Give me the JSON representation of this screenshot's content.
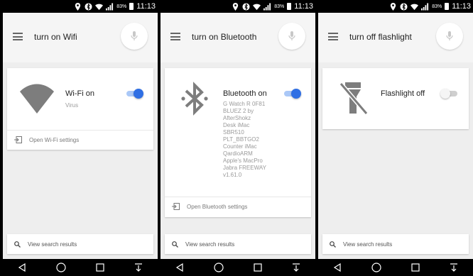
{
  "status_bar": {
    "battery": "83%",
    "time": "11:13"
  },
  "screens": [
    {
      "query": "turn on Wifi",
      "card": {
        "title": "Wi-Fi on",
        "subtitle": "Virus",
        "toggle": "on",
        "action_label": "Open Wi-Fi settings"
      },
      "results_label": "View search results"
    },
    {
      "query": "turn on Bluetooth",
      "card": {
        "title": "Bluetooth on",
        "devices": [
          "G Watch R 0F81",
          "BLUEZ 2 by",
          "AfterShokz",
          "Desk iMac",
          "SBR510",
          "PLT_BBTGO2",
          "Counter iMac",
          "QardioARM",
          "Apple's MacPro",
          "Jabra FREEWAY",
          "v1.61.0"
        ],
        "toggle": "on",
        "action_label": "Open Bluetooth settings"
      },
      "results_label": "View search results"
    },
    {
      "query": "turn off flashlight",
      "card": {
        "title": "Flashlight off",
        "toggle": "off"
      },
      "results_label": "View search results"
    }
  ],
  "colors": {
    "toggle_on": "#2f6fe4",
    "toggle_track_on": "#aac8f7",
    "icon_gray": "#7d7d7d",
    "background": "#eeeeee"
  },
  "icons": {
    "status": [
      "location-icon",
      "bluetooth-icon",
      "wifi-icon",
      "signal-icon",
      "battery-icon"
    ],
    "navigation": [
      "back-icon",
      "home-icon",
      "recents-icon",
      "notifications-down-icon"
    ]
  }
}
